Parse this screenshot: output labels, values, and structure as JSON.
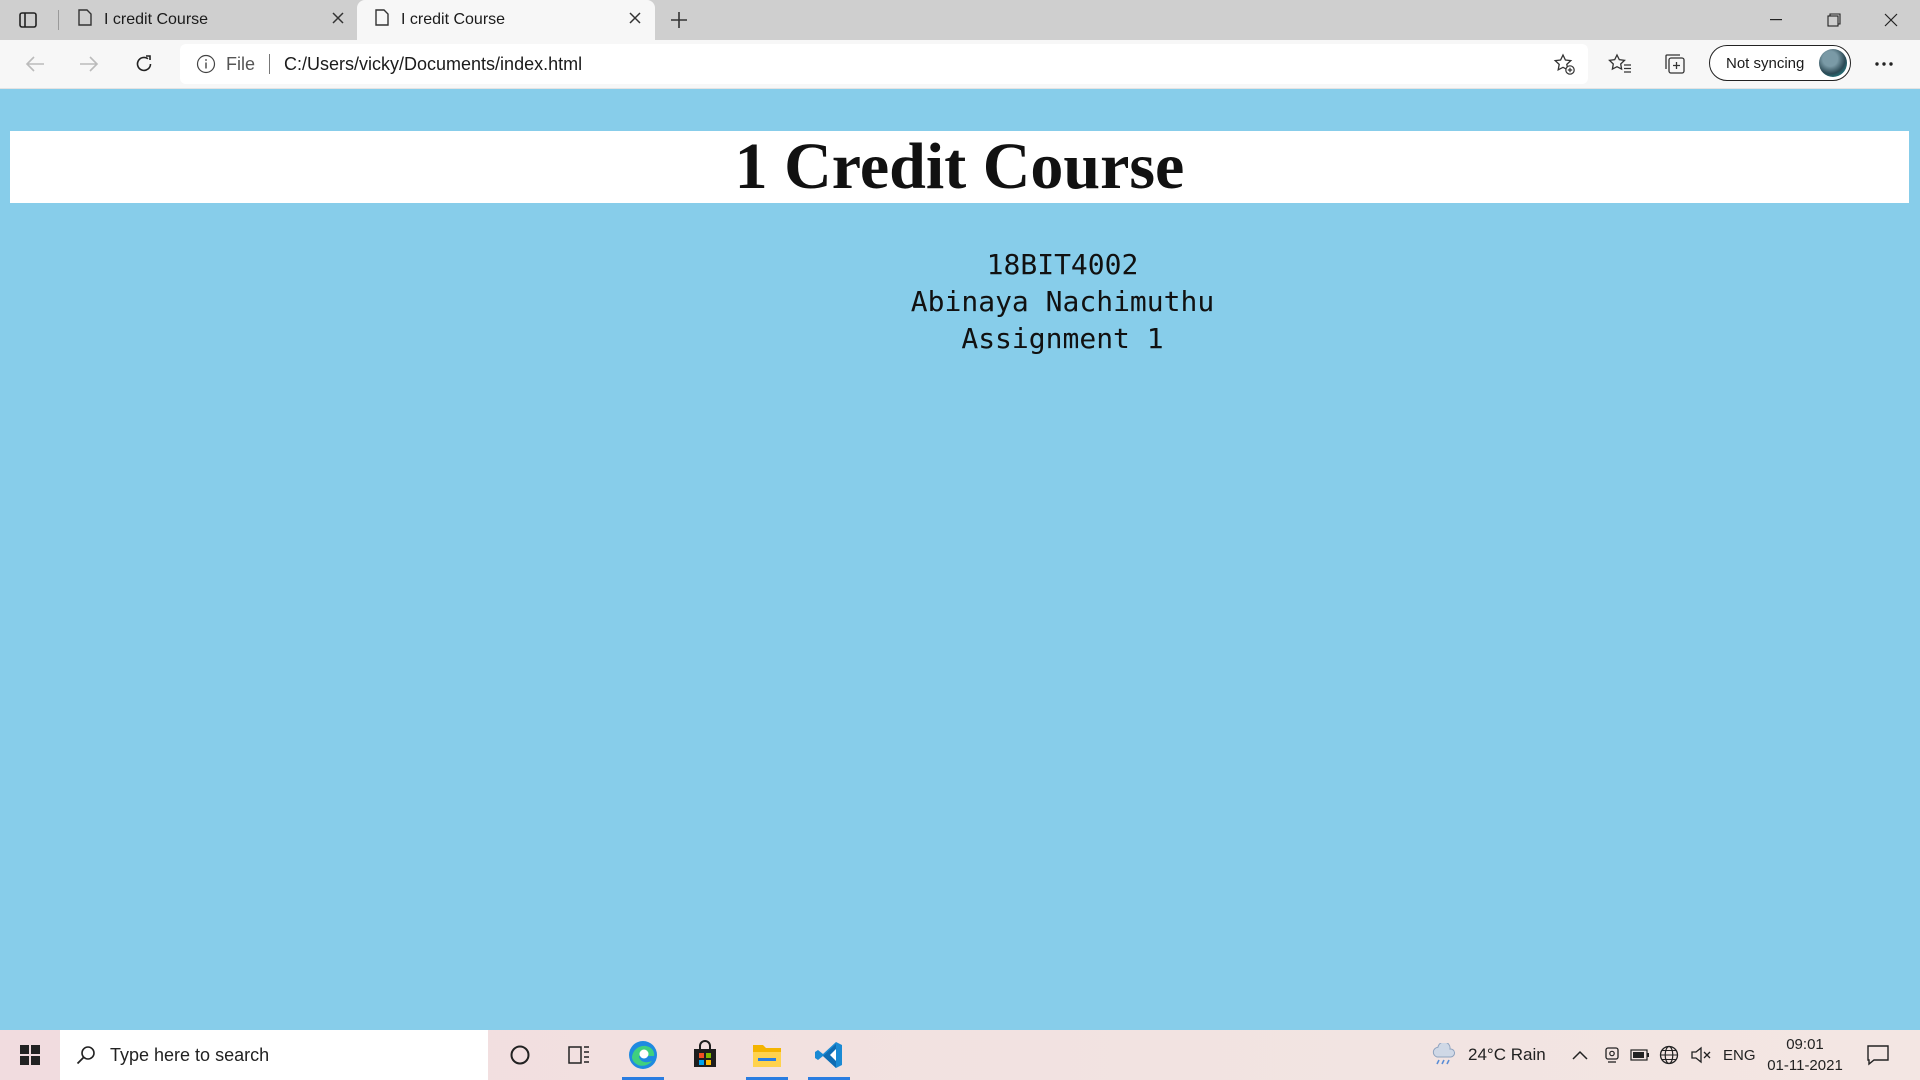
{
  "browser": {
    "tabs": [
      {
        "label": "I credit Course",
        "active": false
      },
      {
        "label": "I credit Course",
        "active": true
      }
    ],
    "address": {
      "scheme_label": "File",
      "url": "C:/Users/vicky/Documents/index.html"
    },
    "profile": {
      "sync_label": "Not syncing"
    }
  },
  "page": {
    "title": "1 Credit Course",
    "lines": [
      "18BIT4002",
      "Abinaya Nachimuthu",
      "Assignment 1"
    ],
    "colors": {
      "background": "#87cdea",
      "banner": "#ffffff"
    }
  },
  "taskbar": {
    "search_placeholder": "Type here to search",
    "weather": "24°C  Rain",
    "language": "ENG",
    "time": "09:01",
    "date": "01-11-2021"
  }
}
